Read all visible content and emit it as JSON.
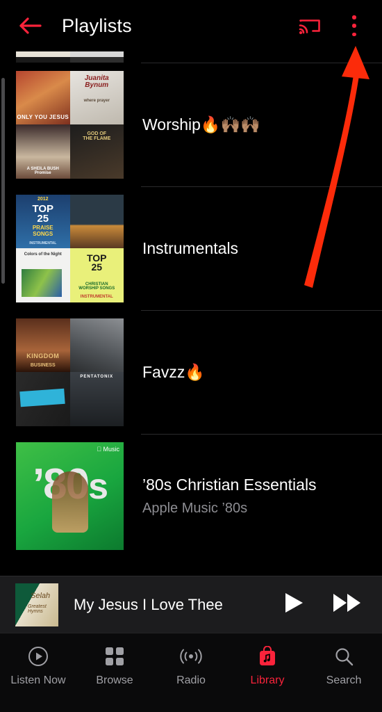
{
  "header": {
    "title": "Playlists",
    "back_icon": "arrow-left-icon",
    "cast_icon": "airplay-cast-icon",
    "overflow_icon": "more-vertical-icon",
    "accent_color": "#fa233b"
  },
  "playlists": [
    {
      "title": "Worship🔥🙌🏽🙌🏽",
      "subtitle": "",
      "artwork": "four-up-album-grid"
    },
    {
      "title": "Instrumentals",
      "subtitle": "",
      "artwork": "four-up-album-grid"
    },
    {
      "title": "Favzz🔥",
      "subtitle": "",
      "artwork": "four-up-album-grid"
    },
    {
      "title": "’80s Christian Essentials",
      "subtitle": "Apple Music ’80s",
      "artwork": "apple-music-80s-cover"
    }
  ],
  "now_playing": {
    "title": "My Jesus I Love Thee",
    "artwork": "selah-album-art",
    "play_icon": "play-icon",
    "next_icon": "fast-forward-icon"
  },
  "tabs": [
    {
      "label": "Listen Now",
      "icon": "play-circle-icon",
      "active": false
    },
    {
      "label": "Browse",
      "icon": "grid-squares-icon",
      "active": false
    },
    {
      "label": "Radio",
      "icon": "radio-waves-icon",
      "active": false
    },
    {
      "label": "Library",
      "icon": "library-bag-icon",
      "active": true
    },
    {
      "label": "Search",
      "icon": "search-icon",
      "active": false
    }
  ],
  "annotation": {
    "arrow": "red-arrow-pointing-to-overflow-menu",
    "color": "#fc2b0a"
  }
}
